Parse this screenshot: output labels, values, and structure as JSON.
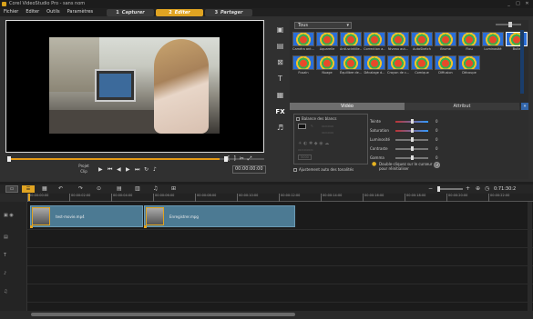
{
  "window": {
    "title": "Corel VideoStudio Pro - sans nom",
    "controls": [
      "_",
      "□",
      "✕"
    ]
  },
  "menu": [
    "Fichier",
    "Editer",
    "Outils",
    "Paramètres"
  ],
  "steps": [
    {
      "num": "1",
      "label": "Capturer",
      "active": false
    },
    {
      "num": "2",
      "label": "Editer",
      "active": true
    },
    {
      "num": "3",
      "label": "Partager",
      "active": false
    }
  ],
  "player": {
    "project_label": "Projet",
    "clip_label": "Clip",
    "timecode": "00:00:00:00",
    "marker_in": "[",
    "marker_out": "]"
  },
  "library": {
    "dropdown_value": "Tous",
    "thumbnails": [
      "Caméra ant...",
      "Aquarelle",
      "Anti-scintille...",
      "Correction a...",
      "Niveau aut...",
      "AutoSketch",
      "Brume",
      "Flou",
      "Luminosité",
      "Bulle",
      "Fusain",
      "Nuage",
      "Équilibre de...",
      "Décalage d...",
      "Crayon de c...",
      "Comique",
      "Diffusion",
      "Découpe"
    ],
    "selected_index": 9
  },
  "attribute_tabs": [
    {
      "label": "Vidéo",
      "active": true
    },
    {
      "label": "Attribut",
      "active": false
    }
  ],
  "attributes": {
    "white_balance_label": "Balance des blancs",
    "auto_tone_label": "Ajustement auto des tonalités",
    "hint": "Double-cliquez sur le curseur pour réinitialiser",
    "sliders": [
      {
        "name": "Teinte",
        "value": "0"
      },
      {
        "name": "Saturation",
        "value": "0"
      },
      {
        "name": "Luminosité",
        "value": "0"
      },
      {
        "name": "Contraste",
        "value": "0"
      },
      {
        "name": "Gamma",
        "value": "0"
      }
    ]
  },
  "timeline": {
    "timecode": "0:71:30:2",
    "ruler": [
      "00:00:00:00",
      "00:00:02:00",
      "00:00:04:00",
      "00:00:06:00",
      "00:00:08:00",
      "00:00:10:00",
      "00:00:12:00",
      "00:00:14:00",
      "00:00:16:00",
      "00:00:18:00",
      "00:00:20:00",
      "00:00:22:00"
    ],
    "clips": [
      {
        "name": "test-movie.mp4"
      },
      {
        "name": "Enregistrer.mpg"
      }
    ]
  },
  "colors": {
    "accent": "#e0a422",
    "clip": "#4c7a93"
  }
}
